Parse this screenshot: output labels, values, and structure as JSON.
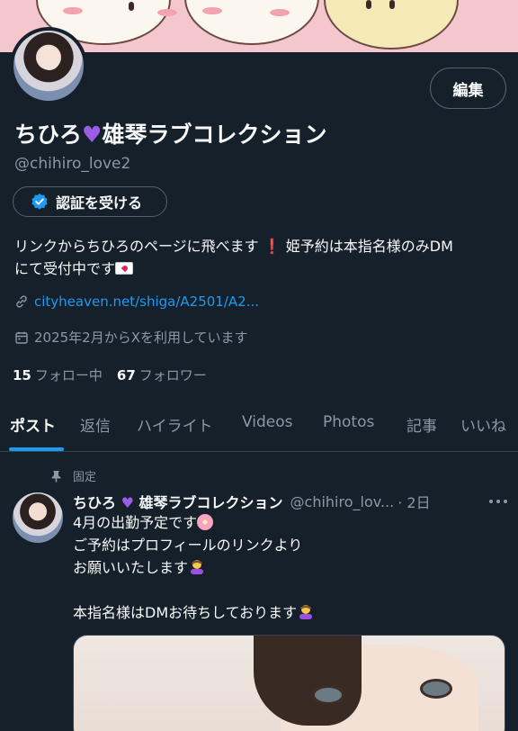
{
  "profile": {
    "edit_label": "編集",
    "name_part1": "ちひろ",
    "name_part2": "雄琴ラブコレクション",
    "handle": "@chihiro_love2",
    "verify_label": "認証を受ける",
    "bio_line1": "リンクからちひろのページに飛べます",
    "bio_line1b": "姫予約は本指名様のみDM",
    "bio_line2": "にて受付中です",
    "link": "cityheaven.net/shiga/A2501/A2...",
    "joined": "2025年2月からXを利用しています",
    "following_count": "15",
    "following_label": "フォロー中",
    "followers_count": "67",
    "followers_label": "フォロワー"
  },
  "tabs": [
    "ポスト",
    "返信",
    "ハイライト",
    "Videos",
    "Photos",
    "記事",
    "いいね"
  ],
  "post": {
    "pinned_label": "固定",
    "name_part1": "ちひろ",
    "name_part2": "雄琴ラブコレクション",
    "handle": "@chihiro_lov...",
    "time": "· 2日",
    "line1": "4月の出勤予定です",
    "line2": "ご予約はプロフィールのリンクより",
    "line3": "お願いいたします",
    "line4": "本指名様はDMお待ちしております"
  },
  "icons": {
    "verify": "verified-badge-icon",
    "link": "link-icon",
    "calendar": "calendar-icon",
    "pin": "pin-icon",
    "more": "more-icon"
  },
  "colors": {
    "background": "#15202b",
    "accent": "#1d9bf0",
    "heart": "#9b5de5",
    "muted": "#8b98a5"
  }
}
